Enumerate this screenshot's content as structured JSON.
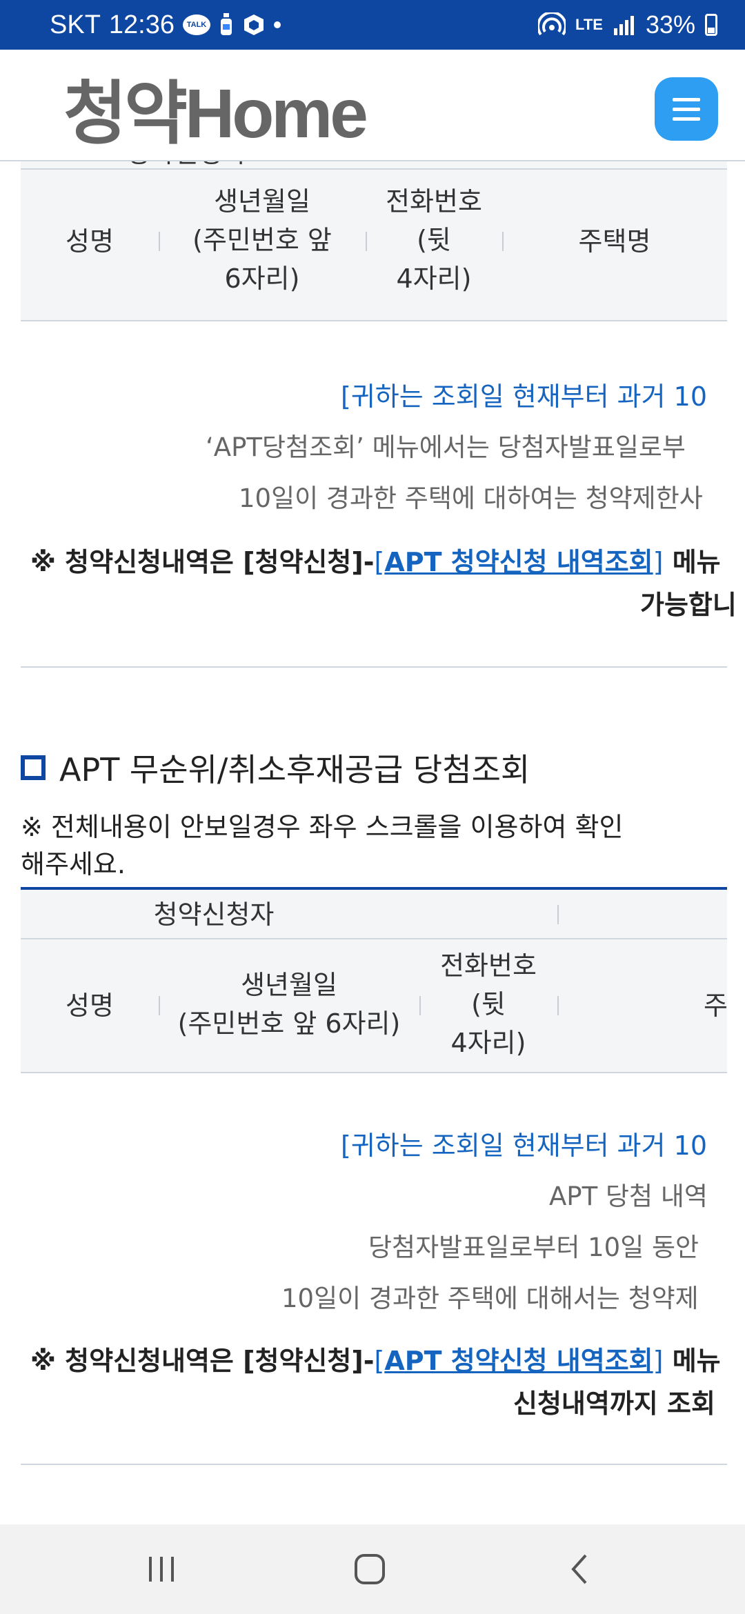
{
  "status_bar": {
    "carrier": "SKT",
    "time": "12:36",
    "talk_badge": "TALK",
    "network": "LTE",
    "battery": "33%"
  },
  "header": {
    "logo_text": "청약Home",
    "menu_icon": "hamburger-icon"
  },
  "table1": {
    "group_header": "청약신청자",
    "columns": [
      "성명",
      "생년월일\n(주민번호 앞\n6자리)",
      "전화번호\n(뒷\n4자리)",
      "주택명"
    ]
  },
  "notice1": {
    "blue_line": "[귀하는 조회일 현재부터 과거 10",
    "gray_line1": "‘APT당첨조회’ 메뉴에서는 당첨자발표일로부",
    "gray_line2": "10일이 경과한 주택에 대하여는 청약제한사",
    "bold_prefix": "※ 청약신청내역은 ",
    "bold_menu": "청약신청",
    "link_text": "APT 청약신청 내역조회",
    "bold_suffix": "메뉴",
    "bold_line2": "가능합니"
  },
  "section2": {
    "title": "APT 무순위/취소후재공급 당첨조회",
    "hint": "※ 전체내용이 안보일경우 좌우 스크롤을 이용하여 확인해주세요."
  },
  "table2": {
    "group_header": "청약신청자",
    "columns": [
      "성명",
      "생년월일\n(주민번호 앞 6자리)",
      "전화번호\n(뒷\n4자리)",
      "주"
    ]
  },
  "notice2": {
    "blue_line": "[귀하는 조회일 현재부터 과거 10",
    "gray_line1": "APT 당첨 내역",
    "gray_line2": "당첨자발표일로부터 10일 동안",
    "gray_line3": "10일이 경과한 주택에 대해서는 청약제",
    "bold_prefix": "※ 청약신청내역은 ",
    "bold_menu": "청약신청",
    "link_text": "APT 청약신청 내역조회",
    "bold_suffix": "메뉴",
    "bold_line2": "신청내역까지 조회"
  },
  "nav": {
    "recent": "recent-apps-icon",
    "home": "home-icon",
    "back": "back-icon"
  }
}
